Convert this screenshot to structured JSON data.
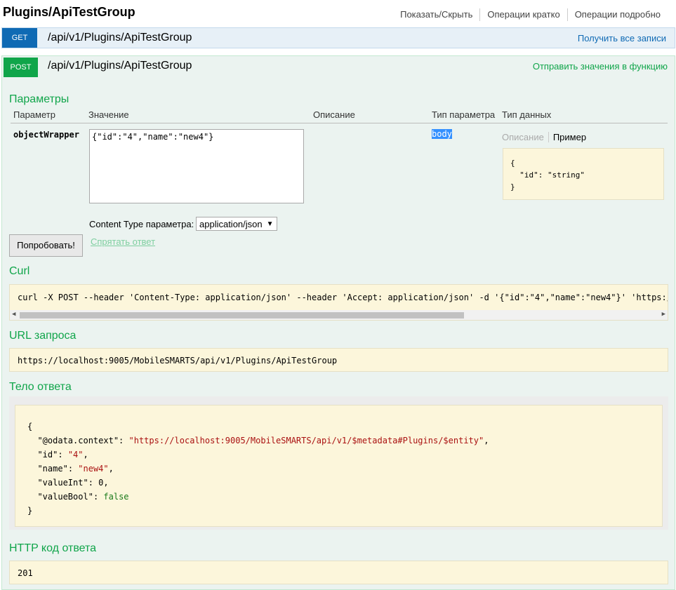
{
  "header": {
    "title": "Plugins/ApiTestGroup",
    "links": [
      "Показать/Скрыть",
      "Операции кратко",
      "Операции подробно"
    ]
  },
  "get_op": {
    "method": "GET",
    "path": "/api/v1/Plugins/ApiTestGroup",
    "summary": "Получить все записи"
  },
  "post_op": {
    "method": "POST",
    "path": "/api/v1/Plugins/ApiTestGroup",
    "summary": "Отправить значения в функцию"
  },
  "params": {
    "title": "Параметры",
    "columns": [
      "Параметр",
      "Значение",
      "Описание",
      "Тип параметра",
      "Тип данных"
    ],
    "param_name": "objectWrapper",
    "param_value": "{\"id\":\"4\",\"name\":\"new4\"}",
    "param_type": "body",
    "data_tabs": [
      "Описание",
      "Пример"
    ],
    "model_example": "{\n  \"id\": \"string\"\n}",
    "content_type_label": "Content Type параметра:",
    "content_type_value": "application/json"
  },
  "buttons": {
    "try": "Попробовать!",
    "hide_response": "Спрятать ответ"
  },
  "curl": {
    "title": "Curl",
    "command": "curl -X POST --header 'Content-Type: application/json' --header 'Accept: application/json' -d '{\"id\":\"4\",\"name\":\"new4\"}' 'https://"
  },
  "request_url": {
    "title": "URL запроса",
    "url": "https://localhost:9005/MobileSMARTS/api/v1/Plugins/ApiTestGroup"
  },
  "response_body": {
    "title": "Тело ответа",
    "open": "{",
    "close": "}",
    "fields": [
      {
        "key": "\"@odata.context\"",
        "value": "\"https://localhost:9005/MobileSMARTS/api/v1/$metadata#Plugins/$entity\"",
        "kind": "s",
        "comma": ","
      },
      {
        "key": "\"id\"",
        "value": "\"4\"",
        "kind": "s",
        "comma": ","
      },
      {
        "key": "\"name\"",
        "value": "\"new4\"",
        "kind": "s",
        "comma": ","
      },
      {
        "key": "\"valueInt\"",
        "value": "0",
        "kind": "n",
        "comma": ","
      },
      {
        "key": "\"valueBool\"",
        "value": "false",
        "kind": "b",
        "comma": ""
      }
    ]
  },
  "response_code": {
    "title": "HTTP код ответа",
    "code": "201"
  },
  "colors": {
    "get": "#0f6ab4",
    "post": "#10a54a",
    "code_bg": "#fcf6db"
  }
}
